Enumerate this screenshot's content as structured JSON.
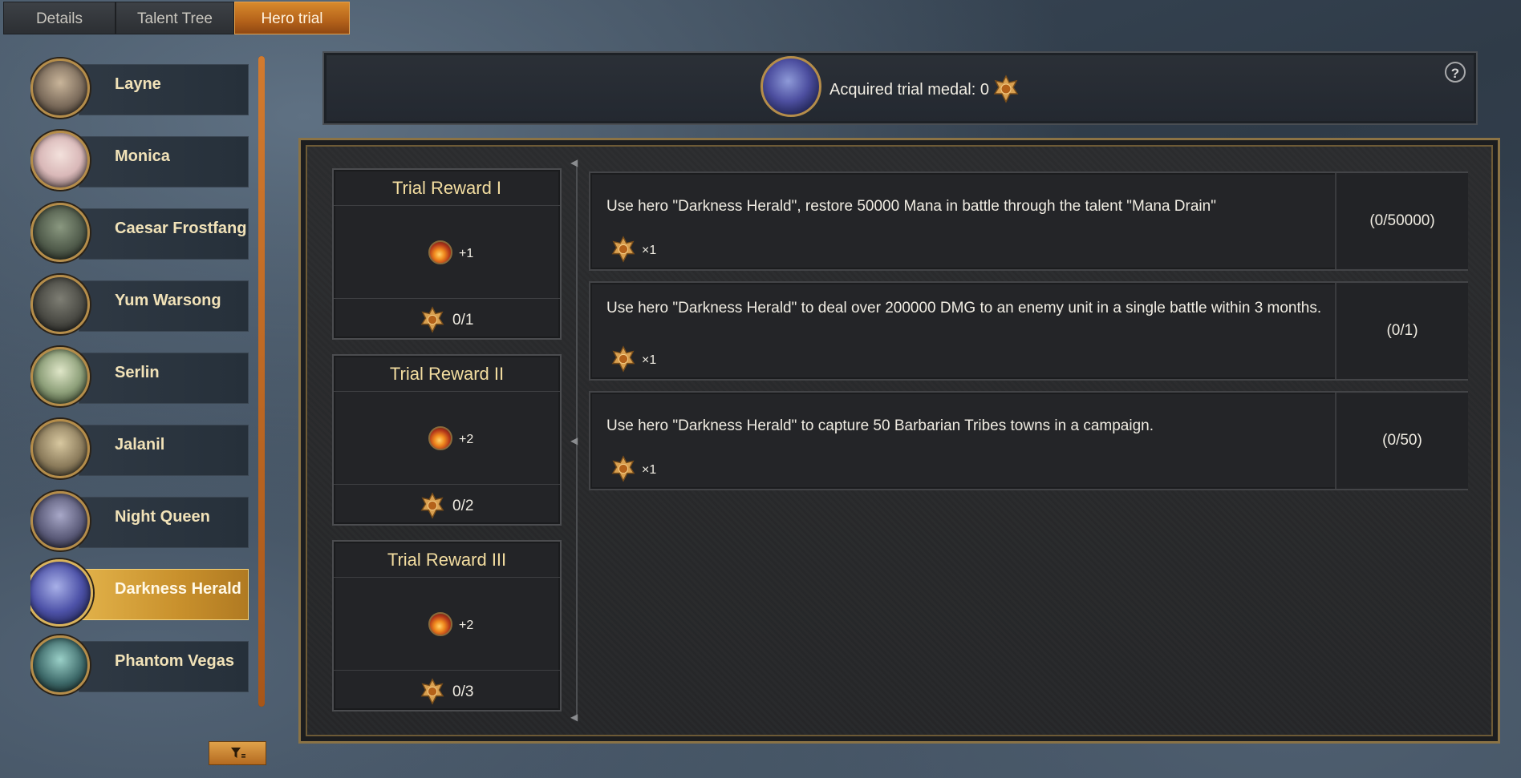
{
  "tabs": [
    {
      "label": "Details",
      "active": false
    },
    {
      "label": "Talent Tree",
      "active": false
    },
    {
      "label": "Hero trial",
      "active": true
    }
  ],
  "heroes": [
    {
      "name": "Layne",
      "selected": false,
      "portrait_color": "#7a6a5a"
    },
    {
      "name": "Monica",
      "selected": false,
      "portrait_color": "#d9b8b8"
    },
    {
      "name": "Caesar Frostfang",
      "selected": false,
      "portrait_color": "#4f5a4a"
    },
    {
      "name": "Yum Warsong",
      "selected": false,
      "portrait_color": "#4a4a44"
    },
    {
      "name": "Serlin",
      "selected": false,
      "portrait_color": "#8ea07a"
    },
    {
      "name": "Jalanil",
      "selected": false,
      "portrait_color": "#8a7a5a"
    },
    {
      "name": "Night Queen",
      "selected": false,
      "portrait_color": "#5a5a78"
    },
    {
      "name": "Darkness Herald",
      "selected": true,
      "portrait_color": "#4d52a8"
    },
    {
      "name": "Phantom Vegas",
      "selected": false,
      "portrait_color": "#3e6a6a"
    }
  ],
  "medal_header": {
    "label": "Acquired trial medal: 0",
    "help_symbol": "?"
  },
  "rewards": [
    {
      "title": "Trial Reward I",
      "item_qty": "+1",
      "progress": "0/1"
    },
    {
      "title": "Trial Reward II",
      "item_qty": "+2",
      "progress": "0/2"
    },
    {
      "title": "Trial Reward III",
      "item_qty": "+2",
      "progress": "0/3"
    }
  ],
  "tasks": [
    {
      "description": "Use hero \"Darkness Herald\", restore 50000 Mana in battle through the talent \"Mana Drain\"",
      "medal_qty": "×1",
      "progress": "(0/50000)"
    },
    {
      "description": "Use hero \"Darkness Herald\" to deal over 200000 DMG to an enemy unit in a single battle within 3 months.",
      "medal_qty": "×1",
      "progress": "(0/1)"
    },
    {
      "description": "Use hero \"Darkness Herald\" to capture 50 Barbarian Tribes towns in a campaign.",
      "medal_qty": "×1",
      "progress": "(0/50)"
    }
  ],
  "colors": {
    "accent_orange": "#c8782a",
    "selected_gold": "#d9a23e",
    "title_gold": "#f3dda0"
  },
  "icons": {
    "medal": "trial-medal-icon",
    "orb": "fire-orb-icon",
    "filter": "filter-icon",
    "help": "help-icon"
  }
}
